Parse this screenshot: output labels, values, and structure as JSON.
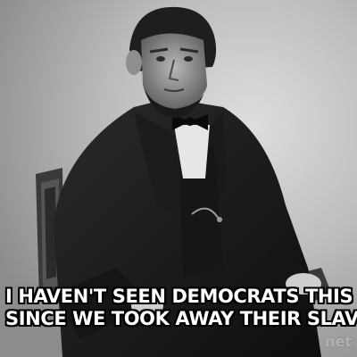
{
  "caption": {
    "line1": "I HAVEN'T SEEN DEMOCRATS THIS ANGRY",
    "line2": "SINCE WE TOOK AWAY THEIR SLAVES"
  },
  "watermark": {
    "text": "net"
  },
  "colors": {
    "caption_text": "#ffffff",
    "caption_outline": "#000000",
    "background": "#bdbdbd"
  }
}
